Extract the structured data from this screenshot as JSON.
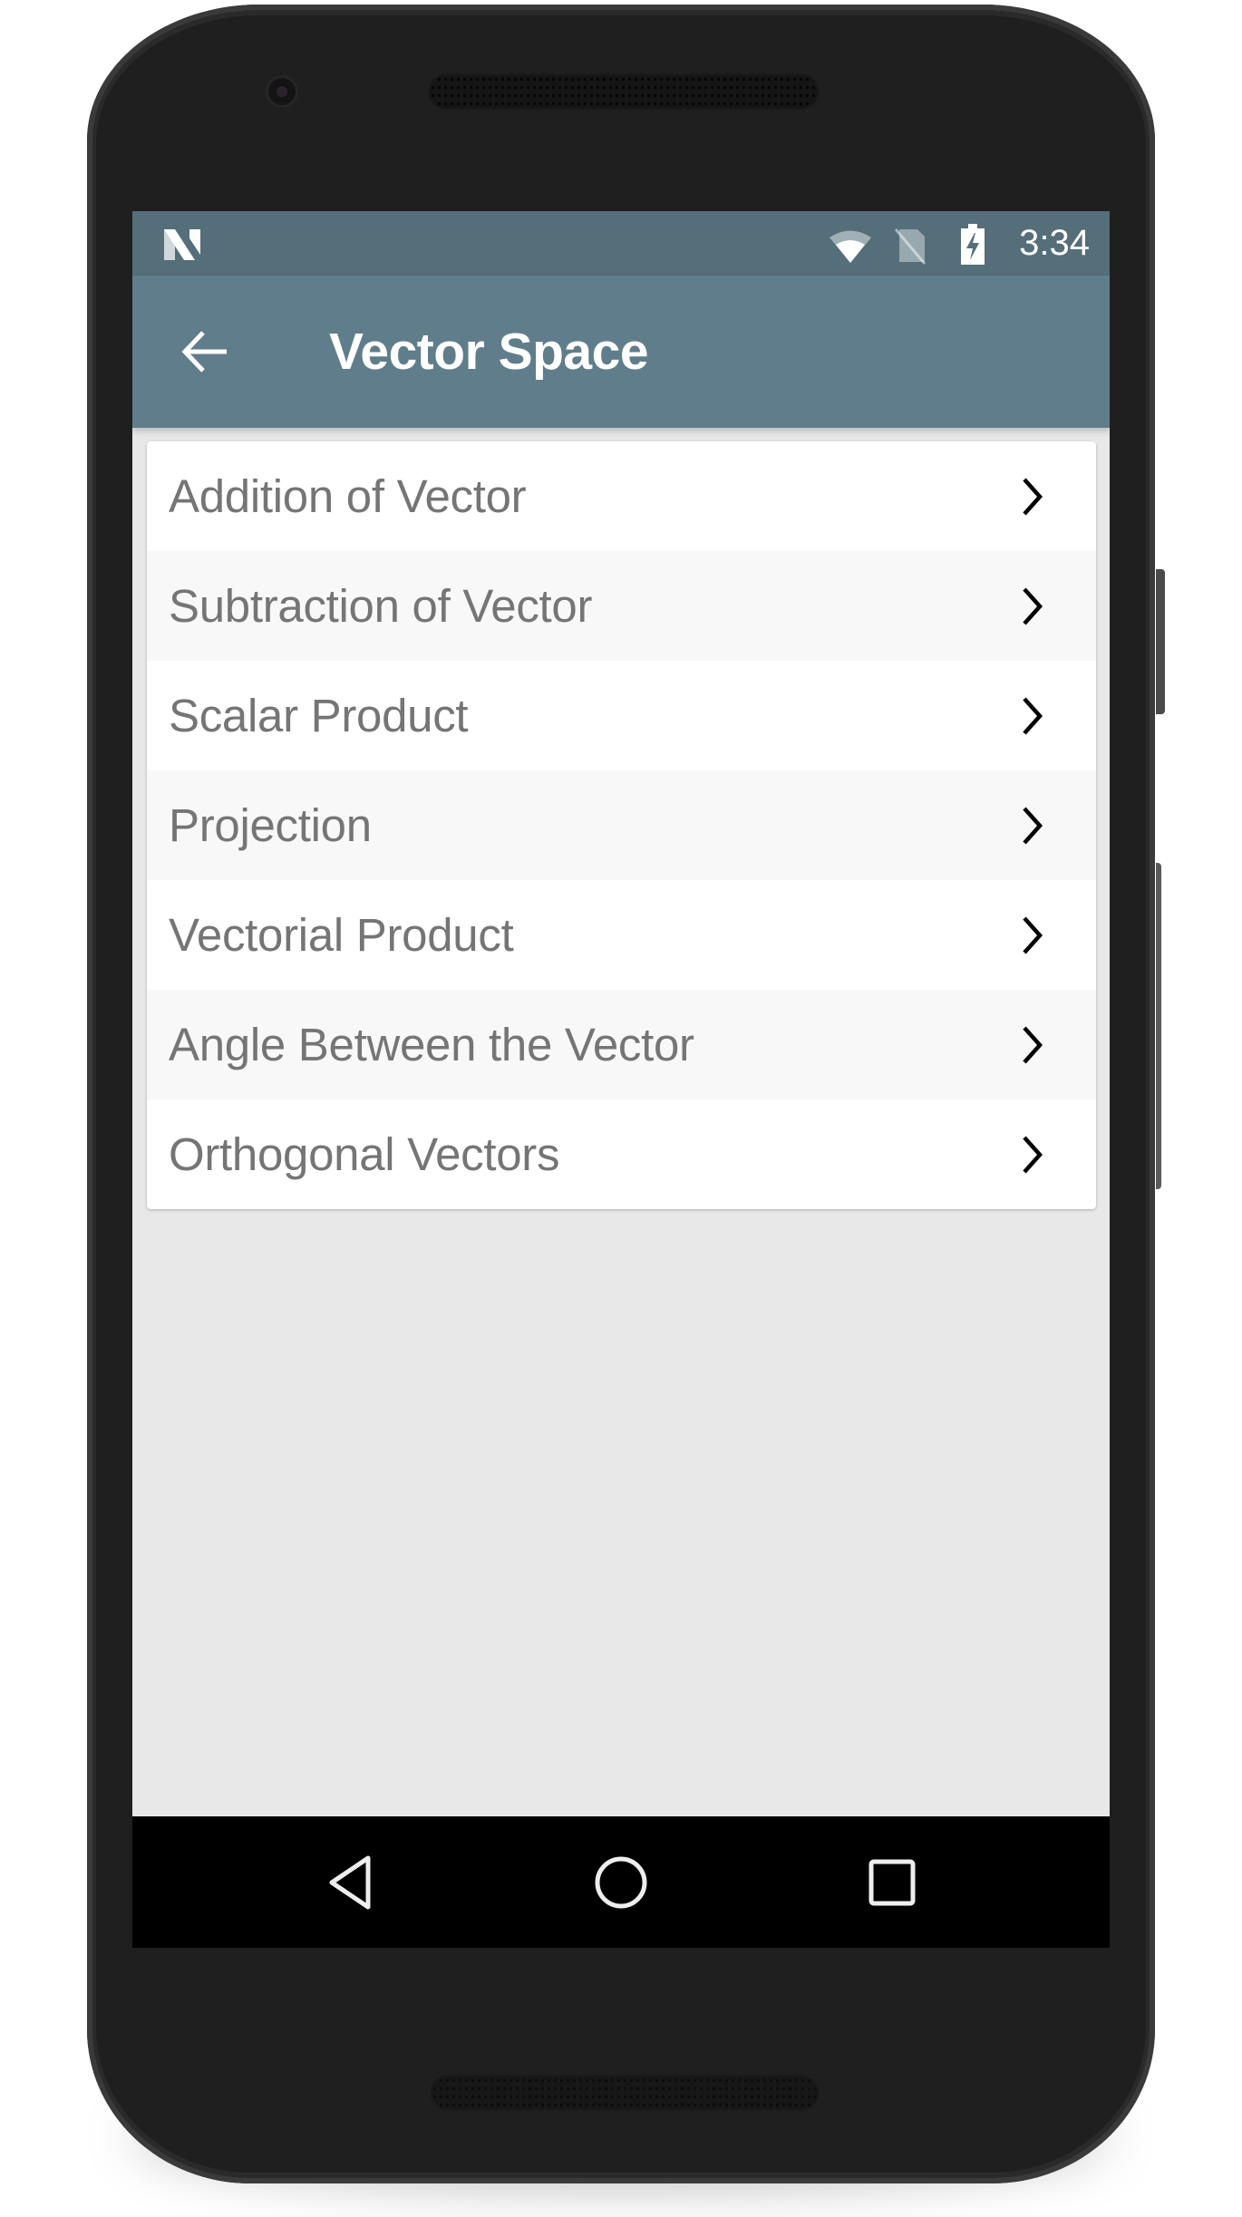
{
  "device": {
    "model_frame": "android-phone"
  },
  "status_bar": {
    "left_icon": "nougat-n-icon",
    "icons": [
      "wifi-icon",
      "no-sim-icon",
      "battery-charging-icon"
    ],
    "time": "3:34",
    "color": "#546E7A"
  },
  "toolbar": {
    "back_icon": "arrow-left-icon",
    "title": "Vector Space",
    "color": "#607D8B"
  },
  "list": {
    "items": [
      {
        "label": "Addition of Vector",
        "icon": "chevron-right-icon"
      },
      {
        "label": "Subtraction of Vector",
        "icon": "chevron-right-icon"
      },
      {
        "label": "Scalar Product",
        "icon": "chevron-right-icon"
      },
      {
        "label": "Projection",
        "icon": "chevron-right-icon"
      },
      {
        "label": "Vectorial Product",
        "icon": "chevron-right-icon"
      },
      {
        "label": "Angle Between the Vector",
        "icon": "chevron-right-icon"
      },
      {
        "label": "Orthogonal Vectors",
        "icon": "chevron-right-icon"
      }
    ]
  },
  "nav_bar": {
    "buttons": [
      {
        "name": "back",
        "icon": "triangle-back-icon"
      },
      {
        "name": "home",
        "icon": "circle-home-icon"
      },
      {
        "name": "recents",
        "icon": "square-recents-icon"
      }
    ]
  }
}
